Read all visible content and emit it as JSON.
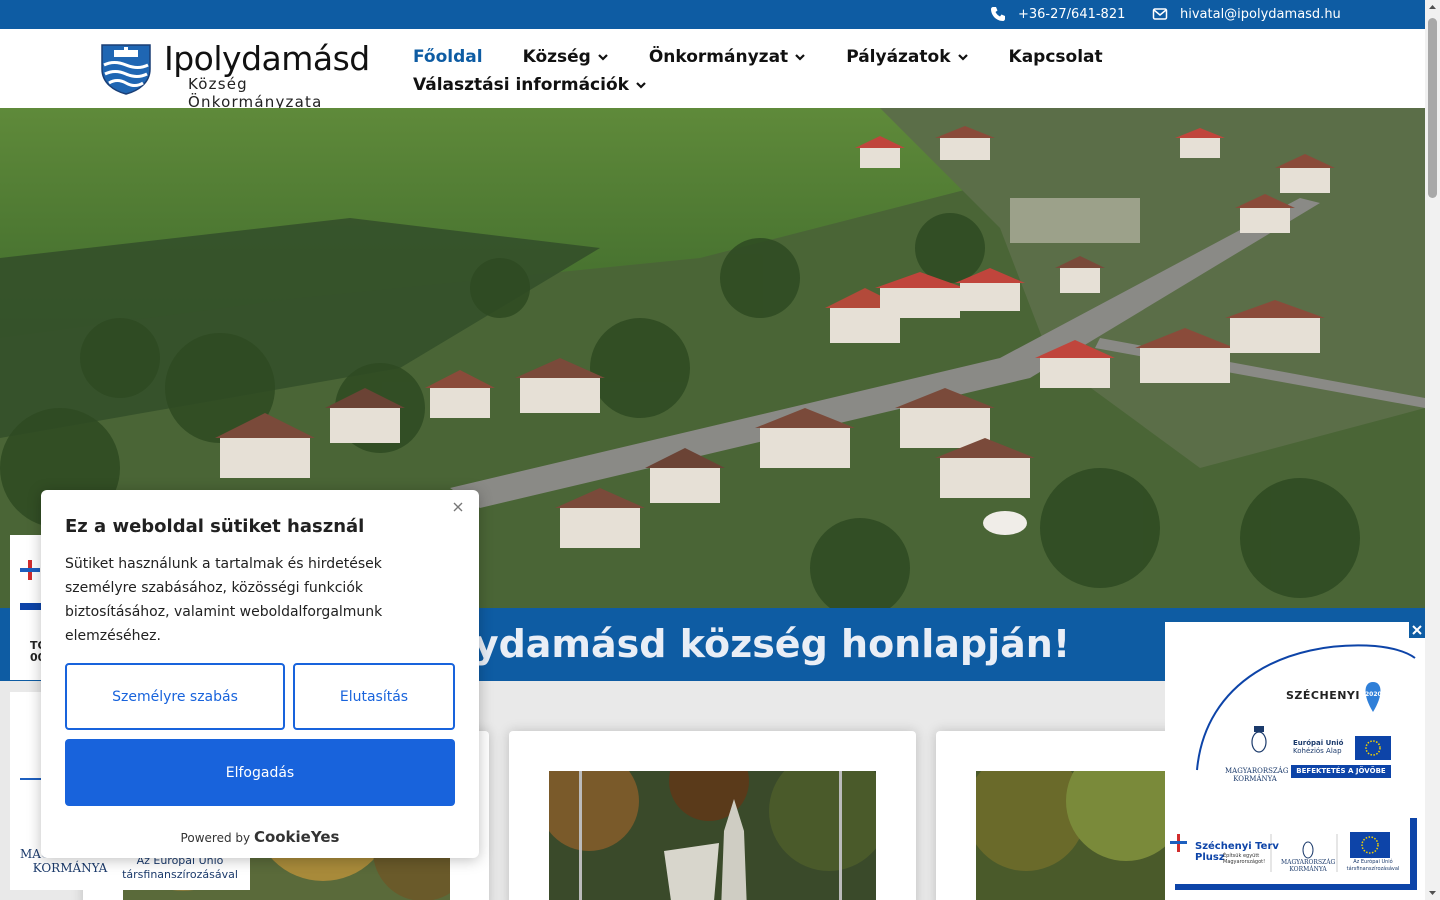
{
  "topbar": {
    "phone": "+36-27/641-821",
    "email": "hivatal@ipolydamasd.hu"
  },
  "logo": {
    "title": "Ipolydamásd",
    "subtitle": "Község Önkormányzata"
  },
  "nav": {
    "items": [
      {
        "label": "Főoldal",
        "active": true,
        "has_dropdown": false
      },
      {
        "label": "Község",
        "active": false,
        "has_dropdown": true
      },
      {
        "label": "Önkormányzat",
        "active": false,
        "has_dropdown": true
      },
      {
        "label": "Pályázatok",
        "active": false,
        "has_dropdown": true
      },
      {
        "label": "Kapcsolat",
        "active": false,
        "has_dropdown": false
      },
      {
        "label": "Választási információk",
        "active": false,
        "has_dropdown": true
      }
    ]
  },
  "hero": {
    "welcome": "k Ipolydamásd község honlapján!"
  },
  "cookie": {
    "title": "Ez a weboldal sütiket használ",
    "body": "Sütiket használunk a tartalmak és hirdetések személyre szabásához, közösségi funkciók biztosításához, valamint weboldalforgalmunk elemzéséhez.",
    "customize_label": "Személyre szabás",
    "reject_label": "Elutasítás",
    "accept_label": "Elfogadás",
    "powered_by": "Powered by",
    "powered_brand": "CookieYes"
  },
  "side_banner": {
    "to_text": "TO\n00",
    "hungary_gov": "Magyarország\nKormánya",
    "eu_text": "Az Európai Unió\ntársfinanszírozásával"
  },
  "badge": {
    "szechenyi": "SZÉCHENYI",
    "year": "2020",
    "hungary_gov": "Magyarország\nKormánya",
    "eu_fund": "Európai Unió\nKohéziós Alap",
    "invest": "BEFEKTETÉS A JÖVŐBE",
    "szechenyi_plus": "Széchenyi Terv\nPlusz",
    "szechenyi_plus_sub": "Építsük együtt\nMagyarországot!",
    "hungary_gov2": "Magyarország\nKormánya",
    "eu_cofinance": "Az Európai Unió\ntársfinanszírozásával"
  },
  "colors": {
    "brand_blue": "#0e5ca3",
    "cookie_blue": "#1863dc"
  }
}
